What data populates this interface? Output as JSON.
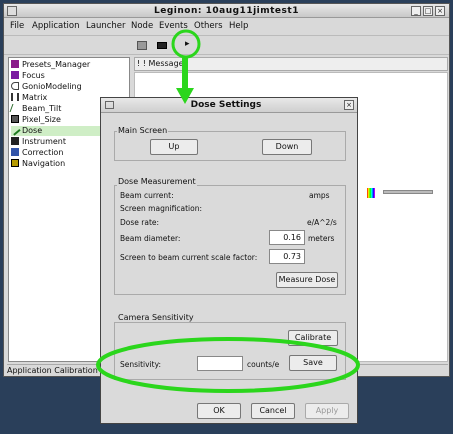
{
  "main_window": {
    "title": "Leginon: 10aug11jimtest1",
    "menu": [
      "File",
      "Application",
      "Launcher",
      "Node",
      "Events",
      "Others",
      "Help"
    ],
    "messages_header": "Message",
    "status_text": "Application Calibration",
    "tree_items": [
      {
        "label": "Presets_Manager",
        "icon_color": "#8a1a8a",
        "selected": false
      },
      {
        "label": "Focus",
        "icon_color": "#7a1aa0",
        "selected": false
      },
      {
        "label": "GonioModeling",
        "icon_color": "#444444",
        "selected": false
      },
      {
        "label": "Matrix",
        "icon_color": "#333333",
        "selected": false
      },
      {
        "label": "Beam_Tilt",
        "icon_color": "#2a6a2a",
        "selected": false
      },
      {
        "label": "Pixel_Size",
        "icon_color": "#555555",
        "selected": false
      },
      {
        "label": "Dose",
        "icon_color": "#1f7a1f",
        "selected": true
      },
      {
        "label": "Instrument",
        "icon_color": "#222222",
        "selected": false
      },
      {
        "label": "Correction",
        "icon_color": "#3355aa",
        "selected": false
      },
      {
        "label": "Navigation",
        "icon_color": "#b59a00",
        "selected": false
      }
    ]
  },
  "dose_dialog": {
    "title": "Dose Settings",
    "main_screen": {
      "label": "Main Screen",
      "up": "Up",
      "down": "Down"
    },
    "dose_measurement": {
      "label": "Dose Measurement",
      "beam_current_label": "Beam current:",
      "beam_current_unit": "amps",
      "screen_mag_label": "Screen magnification:",
      "dose_rate_label": "Dose rate:",
      "dose_rate_unit": "e/A^2/s",
      "beam_diameter_label": "Beam diameter:",
      "beam_diameter_value": "0.16",
      "beam_diameter_unit": "meters",
      "scale_factor_label": "Screen to beam current scale factor:",
      "scale_factor_value": "0.73",
      "measure_button": "Measure Dose"
    },
    "camera_sensitivity": {
      "label": "Camera Sensitivity",
      "calibrate_button": "Calibrate",
      "sensitivity_label": "Sensitivity:",
      "sensitivity_value": "",
      "sensitivity_unit": "counts/e",
      "save_button": "Save"
    },
    "buttons": {
      "ok": "OK",
      "cancel": "Cancel",
      "apply": "Apply"
    }
  },
  "annotation_colors": {
    "highlight": "#2bd61c"
  }
}
